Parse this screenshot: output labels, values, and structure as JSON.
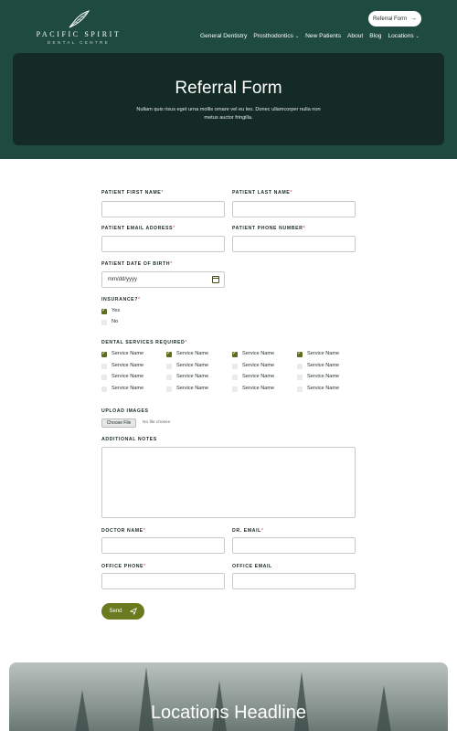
{
  "header": {
    "brand": "PACIFIC SPIRIT",
    "brand_sub": "DENTAL CENTRE",
    "cta_label": "Referral Form",
    "nav": [
      {
        "label": "General Dentistry",
        "has_dropdown": false
      },
      {
        "label": "Prosthodontics",
        "has_dropdown": true
      },
      {
        "label": "New Patients",
        "has_dropdown": false
      },
      {
        "label": "About",
        "has_dropdown": false
      },
      {
        "label": "Blog",
        "has_dropdown": false
      },
      {
        "label": "Locations",
        "has_dropdown": true
      }
    ]
  },
  "hero": {
    "title": "Referral Form",
    "text": "Nullam quis risus eget urna mollis ornare vel eu leo. Donec ullamcorper nulla non metus auctor fringilla."
  },
  "form": {
    "patient_first_name": {
      "label": "PATIENT FIRST NAME",
      "required": "*",
      "value": ""
    },
    "patient_last_name": {
      "label": "PATIENT LAST NAME",
      "required": "*",
      "value": ""
    },
    "patient_email": {
      "label": "PATIENT EMAIL ADDRESS",
      "required": "*",
      "value": ""
    },
    "patient_phone": {
      "label": "PATIENT PHONE NUMBER",
      "required": "*",
      "value": ""
    },
    "patient_dob": {
      "label": "PATIENT DATE OF BIRTH",
      "required": "*",
      "placeholder": "mm/dd/yyyy"
    },
    "insurance": {
      "label": "INSURANCE?",
      "required": "*",
      "options": [
        {
          "label": "Yes",
          "checked": true
        },
        {
          "label": "No",
          "checked": false
        }
      ]
    },
    "services": {
      "label": "DENTAL SERVICES REQUIRED",
      "required": "*",
      "columns": [
        [
          {
            "label": "Service Name",
            "checked": true
          },
          {
            "label": "Service Name",
            "checked": false
          },
          {
            "label": "Service Name",
            "checked": false
          },
          {
            "label": "Service Name",
            "checked": false
          }
        ],
        [
          {
            "label": "Service Name",
            "checked": true
          },
          {
            "label": "Service Name",
            "checked": false
          },
          {
            "label": "Service Name",
            "checked": false
          },
          {
            "label": "Service Name",
            "checked": false
          }
        ],
        [
          {
            "label": "Service Name",
            "checked": true
          },
          {
            "label": "Service Name",
            "checked": false
          },
          {
            "label": "Service Name",
            "checked": false
          },
          {
            "label": "Service Name",
            "checked": false
          }
        ],
        [
          {
            "label": "Service Name",
            "checked": true
          },
          {
            "label": "Service Name",
            "checked": false
          },
          {
            "label": "Service Name",
            "checked": false
          },
          {
            "label": "Service Name",
            "checked": false
          }
        ]
      ]
    },
    "upload": {
      "label": "UPLOAD IMAGES",
      "button": "Choose File",
      "status": "No file chosen"
    },
    "notes": {
      "label": "ADDITIONAL NOTES",
      "value": ""
    },
    "doctor_name": {
      "label": "DOCTOR NAME",
      "required": "*",
      "value": ""
    },
    "dr_email": {
      "label": "DR. EMAIL",
      "required": "*",
      "value": ""
    },
    "office_phone": {
      "label": "OFFICE PHONE",
      "required": "*",
      "value": ""
    },
    "office_email": {
      "label": "OFFICE EMAIL",
      "value": ""
    },
    "submit_label": "Send"
  },
  "locations": {
    "title": "Locations Headline"
  },
  "colors": {
    "header_bg": "#1f4a40",
    "hero_bg": "#142a25",
    "accent": "#6a7a1e",
    "required": "#c0392b"
  }
}
